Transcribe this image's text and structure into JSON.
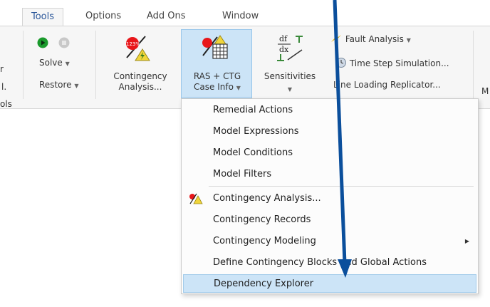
{
  "tabs": [
    {
      "label": "Tools",
      "active": true
    },
    {
      "label": "Options",
      "active": false
    },
    {
      "label": "Add Ons",
      "active": false
    },
    {
      "label": "Window",
      "active": false
    }
  ],
  "ribbon": {
    "left_cutoff": {
      "line1": "r",
      "line2": "l.",
      "line3": "ols"
    },
    "run_group": {
      "solve_label": "Solve",
      "restore_label": "Restore"
    },
    "contingency": {
      "badge": "123%",
      "line1": "Contingency",
      "line2": "Analysis..."
    },
    "ras_ctg": {
      "line1": "RAS + CTG",
      "line2": "Case Info"
    },
    "sensitivities": {
      "top_text": "df",
      "bottom_text": "dx",
      "label": "Sensitivities"
    },
    "tools_list": {
      "fault_analysis": "Fault Analysis",
      "time_step": "Time Step Simulation...",
      "line_loading": "Line Loading Replicator..."
    },
    "right_cutoff": "M"
  },
  "menu": {
    "items": [
      {
        "label": "Remedial Actions"
      },
      {
        "label": "Model Expressions"
      },
      {
        "label": "Model Conditions"
      },
      {
        "label": "Model Filters"
      },
      {
        "label": "Contingency Analysis..."
      },
      {
        "label": "Contingency Records"
      },
      {
        "label": "Contingency Modeling"
      },
      {
        "label": "Define Contingency Blocks and Global Actions"
      },
      {
        "label": "Dependency Explorer"
      }
    ]
  },
  "colors": {
    "accent": "#2b579a",
    "hover": "#cce4f7",
    "annotation_arrow": "#0b4f9c"
  }
}
